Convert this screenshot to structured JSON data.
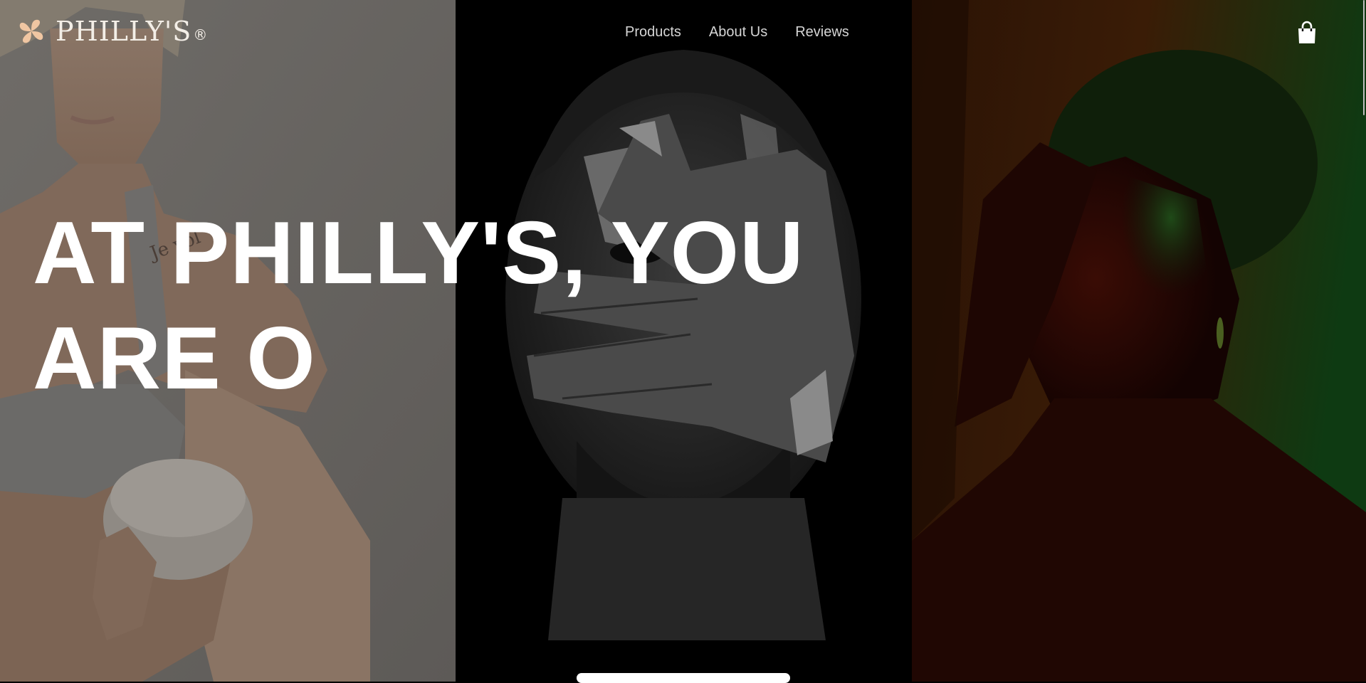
{
  "brand": {
    "name": "PHILLY'S",
    "registered": "®",
    "logo_color": "#f0c6a2",
    "text_color": "#f3eee7"
  },
  "nav": {
    "items": [
      {
        "label": "Products"
      },
      {
        "label": "About Us"
      },
      {
        "label": "Reviews"
      }
    ],
    "cart_icon": "shopping-bag-icon"
  },
  "hero": {
    "headline_line1": "AT PHILLY'S, YOU",
    "headline_line2": "ARE O",
    "panels": [
      "woman-with-bowl-photo",
      "man-covering-face-photo",
      "woman-red-green-light-photo"
    ]
  },
  "colors": {
    "headline": "#ffffff",
    "nav_text": "#d5d5d5",
    "right_panel_red": "#4a0f05",
    "right_panel_green": "#0e3a12"
  }
}
